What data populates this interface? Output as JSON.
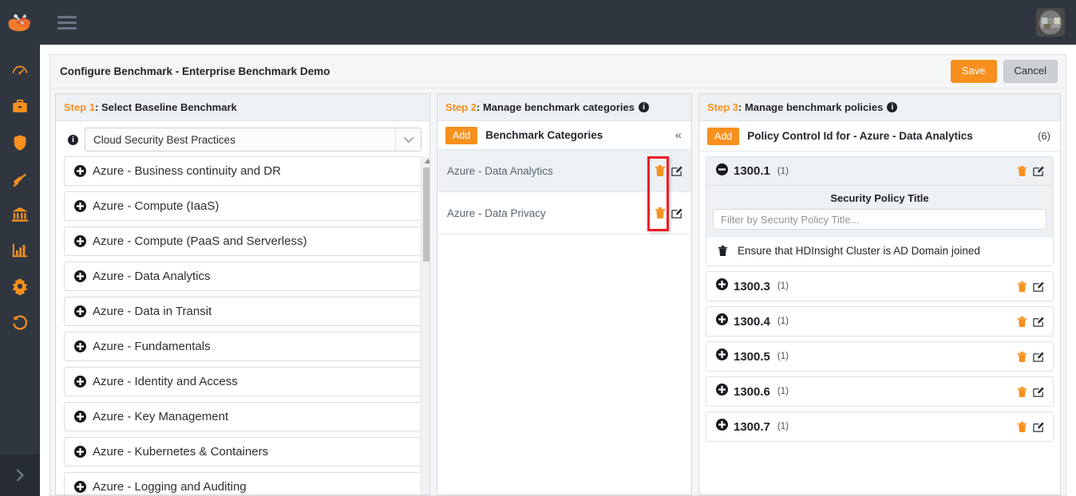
{
  "brand": {
    "logo_icon": "cloud-tools-logo",
    "accent": "#f7901e",
    "nav_bg": "#2f3640"
  },
  "topbar": {
    "menu_icon": "hamburger-icon",
    "avatar_icon": "user-avatar"
  },
  "sidebar": {
    "items": [
      {
        "icon": "dashboard-gauge-icon",
        "name": "dashboard"
      },
      {
        "icon": "briefcase-icon",
        "name": "portfolio"
      },
      {
        "icon": "shield-icon",
        "name": "security"
      },
      {
        "icon": "gavel-icon",
        "name": "compliance"
      },
      {
        "icon": "bank-icon",
        "name": "governance"
      },
      {
        "icon": "bar-chart-icon",
        "name": "reports"
      },
      {
        "icon": "gear-icon",
        "name": "settings"
      },
      {
        "icon": "history-icon",
        "name": "history"
      }
    ],
    "expand_icon": "chevron-right-icon"
  },
  "header": {
    "title": "Configure Benchmark - Enterprise Benchmark Demo",
    "save_label": "Save",
    "cancel_label": "Cancel"
  },
  "step1": {
    "step_tag": "Step 1",
    "step_text": " : Select Baseline Benchmark",
    "info_icon": "info-icon",
    "select_value": "Cloud Security Best Practices",
    "caret_icon": "chevron-down-icon",
    "items": [
      {
        "label": "Azure - Business continuity and DR",
        "icon": "plus-circle-icon"
      },
      {
        "label": "Azure - Compute (IaaS)",
        "icon": "plus-circle-icon"
      },
      {
        "label": "Azure - Compute (PaaS and Serverless)",
        "icon": "plus-circle-icon"
      },
      {
        "label": "Azure - Data Analytics",
        "icon": "plus-circle-icon"
      },
      {
        "label": "Azure - Data in Transit",
        "icon": "plus-circle-icon"
      },
      {
        "label": "Azure - Fundamentals",
        "icon": "plus-circle-icon"
      },
      {
        "label": "Azure - Identity and Access",
        "icon": "plus-circle-icon"
      },
      {
        "label": "Azure - Key Management",
        "icon": "plus-circle-icon"
      },
      {
        "label": "Azure - Kubernetes & Containers",
        "icon": "plus-circle-icon"
      },
      {
        "label": "Azure - Logging and Auditing",
        "icon": "plus-circle-icon"
      }
    ]
  },
  "step2": {
    "step_tag": "Step 2",
    "step_text": " : Manage benchmark categories",
    "info_icon": "info-icon",
    "add_label": "Add",
    "sub_title": "Benchmark Categories",
    "collapse_icon": "chevron-double-left-icon",
    "rows": [
      {
        "name": "Azure - Data Analytics",
        "selected": true,
        "delete_icon": "trash-icon",
        "edit_icon": "edit-icon"
      },
      {
        "name": "Azure - Data Privacy",
        "selected": false,
        "delete_icon": "trash-icon",
        "edit_icon": "edit-icon"
      }
    ]
  },
  "step3": {
    "step_tag": "Step 3",
    "step_text": " : Manage benchmark policies",
    "info_icon": "info-icon",
    "add_label": "Add",
    "sub_title": "Policy Control Id for - Azure - Data Analytics",
    "count": "(6)",
    "expanded": {
      "id": "1300.1",
      "sub": "(1)",
      "toggle_icon": "minus-circle-icon",
      "delete_icon": "trash-icon",
      "edit_icon": "edit-icon",
      "column_header": "Security Policy Title",
      "filter_placeholder": "Filter by Security Policy Title...",
      "filter_value": "",
      "policies": [
        {
          "title": "Ensure that HDInsight Cluster is AD Domain joined",
          "delete_icon": "trash-icon"
        }
      ]
    },
    "collapsed_rows": [
      {
        "id": "1300.3",
        "sub": "(1)",
        "toggle_icon": "plus-circle-icon",
        "delete_icon": "trash-icon",
        "edit_icon": "edit-icon"
      },
      {
        "id": "1300.4",
        "sub": "(1)",
        "toggle_icon": "plus-circle-icon",
        "delete_icon": "trash-icon",
        "edit_icon": "edit-icon"
      },
      {
        "id": "1300.5",
        "sub": "(1)",
        "toggle_icon": "plus-circle-icon",
        "delete_icon": "trash-icon",
        "edit_icon": "edit-icon"
      },
      {
        "id": "1300.6",
        "sub": "(1)",
        "toggle_icon": "plus-circle-icon",
        "delete_icon": "trash-icon",
        "edit_icon": "edit-icon"
      },
      {
        "id": "1300.7",
        "sub": "(1)",
        "toggle_icon": "plus-circle-icon",
        "delete_icon": "trash-icon",
        "edit_icon": "edit-icon"
      }
    ]
  },
  "annotation": {
    "color": "#ee1c25",
    "target": "category-delete-icons"
  }
}
